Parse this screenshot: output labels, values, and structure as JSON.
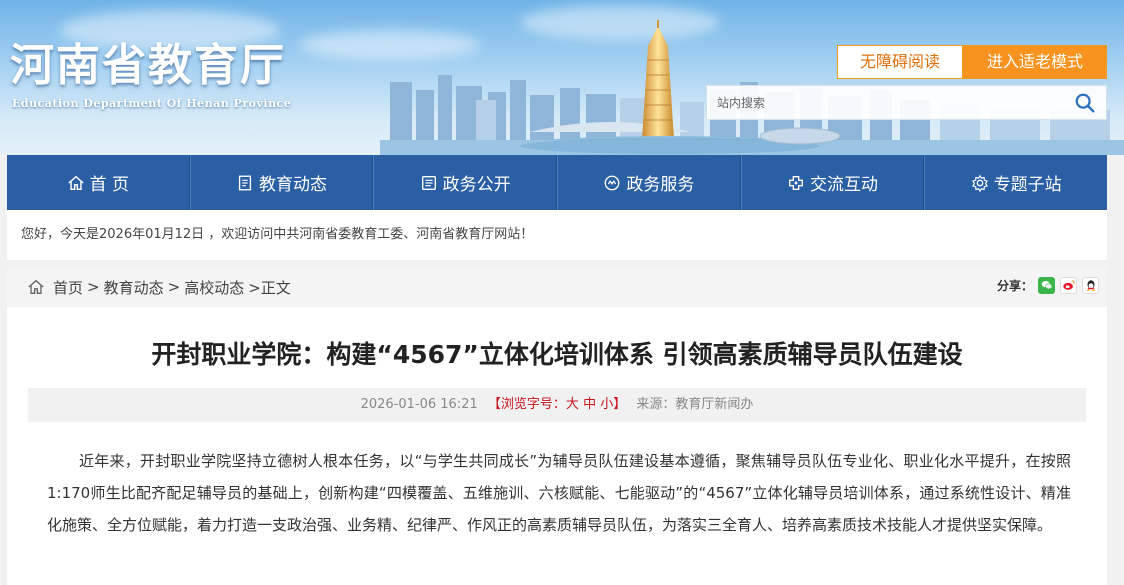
{
  "header": {
    "title": "河南省教育厅",
    "subtitle": "Education Department Of Henan Province",
    "accessibility_label": "无障碍阅读",
    "elder_mode_label": "进入适老模式",
    "search_placeholder": "站内搜索"
  },
  "nav": {
    "items": [
      {
        "label": "首 页",
        "icon": "home-icon"
      },
      {
        "label": "教育动态",
        "icon": "document-icon"
      },
      {
        "label": "政务公开",
        "icon": "book-icon"
      },
      {
        "label": "政务服务",
        "icon": "service-icon"
      },
      {
        "label": "交流互动",
        "icon": "chat-icon"
      },
      {
        "label": "专题子站",
        "icon": "gear-icon"
      }
    ],
    "colors": {
      "background": "#2a5fa4",
      "accent": "#f7931e"
    }
  },
  "welcome": {
    "text": "您好，今天是2026年01月12日 ，欢迎访问中共河南省委教育工委、河南省教育厅网站！"
  },
  "breadcrumb": {
    "items": [
      "首页",
      "教育动态",
      "高校动态"
    ],
    "separator": ">",
    "current": ">正文"
  },
  "share": {
    "label": "分享：",
    "icons": [
      "wechat-icon",
      "weibo-icon",
      "qq-icon"
    ]
  },
  "article": {
    "title": "开封职业学院：构建“4567”立体化培训体系 引领高素质辅导员队伍建设",
    "date": "2026-01-06 16:21",
    "views_prefix": "【浏览字号：",
    "size_large": "大",
    "size_medium": "中",
    "size_small": "小",
    "views_suffix": "】",
    "source": "来源：教育厅新闻办",
    "body": "近年来，开封职业学院坚持立德树人根本任务，以“与学生共同成长”为辅导员队伍建设基本遵循，聚焦辅导员队伍专业化、职业化水平提升，在按照1:170师生比配齐配足辅导员的基础上，创新构建“四模覆盖、五维施训、六核赋能、七能驱动”的“4567”立体化辅导员培训体系，通过系统性设计、精准化施策、全方位赋能，着力打造一支政治强、业务精、纪律严、作风正的高素质辅导员队伍，为落实三全育人、培养高素质技术技能人才提供坚实保障。"
  }
}
